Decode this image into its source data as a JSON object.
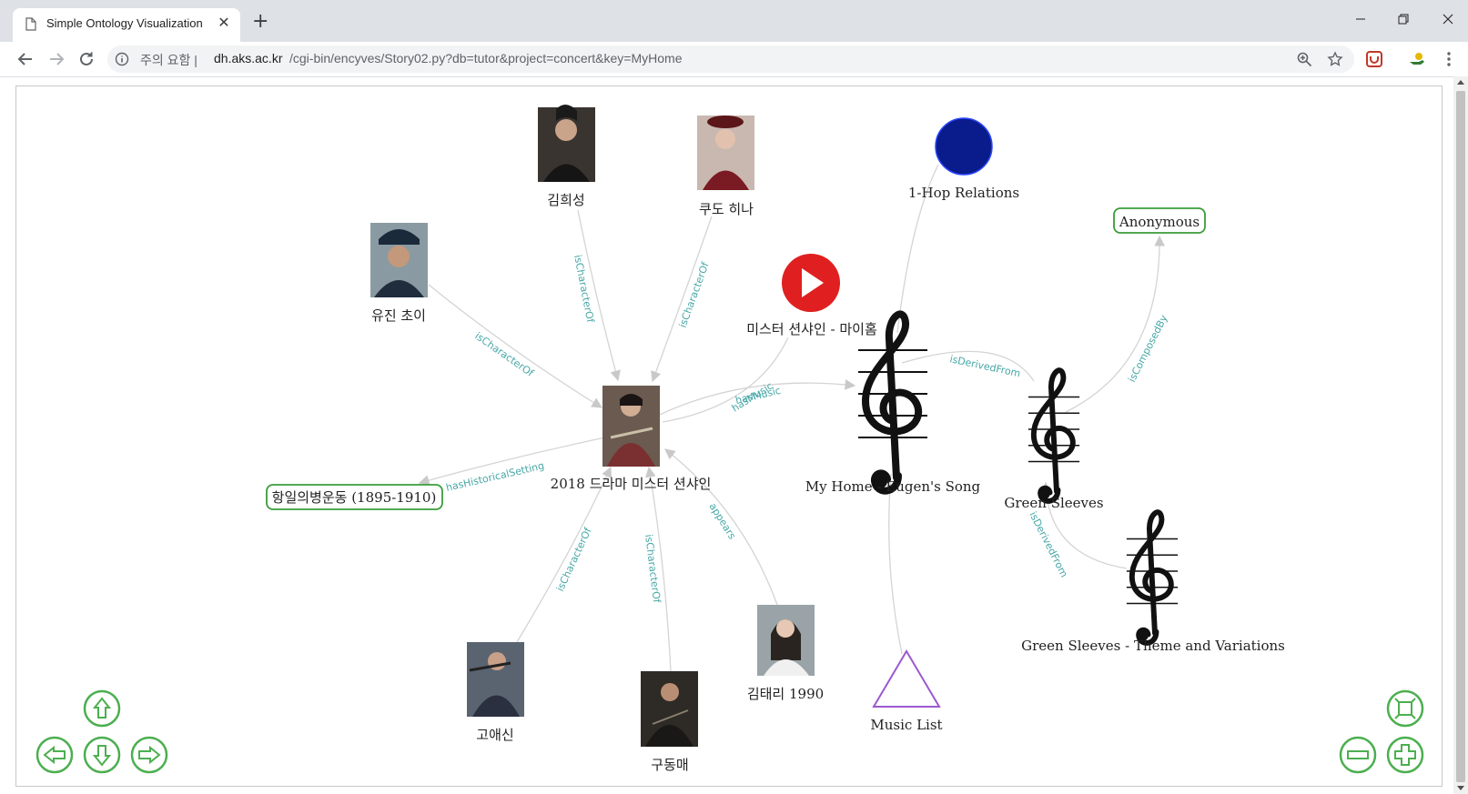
{
  "browser": {
    "tab_title": "Simple Ontology Visualization",
    "tab_close": "✕",
    "new_tab": "+",
    "url_prefix": "주의 요함 |",
    "url_domain": "dh.aks.ac.kr",
    "url_path": "/cgi-bin/encyves/Story02.py?db=tutor&project=concert&key=MyHome",
    "icons": [
      "back-icon",
      "forward-icon",
      "reload-icon",
      "info-icon",
      "zoom-icon",
      "star-icon",
      "extension-icon",
      "profile-icon",
      "menu-icon"
    ]
  },
  "graph": {
    "nodes": {
      "kim_hui_seong": "김희성",
      "kudo_hina": "쿠도 히나",
      "one_hop": "1-Hop Relations",
      "anonymous": "Anonymous",
      "eugene_choi": "유진 초이",
      "video": "미스터 션샤인 - 마이홈",
      "drama": "2018 드라마 미스터 션샤인",
      "my_home": "My Home - Eugen's Song",
      "green_sleeves": "Green Sleeves",
      "righteous_army": "항일의병운동 (1895-1910)",
      "gs_theme": "Green Sleeves - Theme and Variations",
      "go_ae_shin": "고애신",
      "gu_dong_mae": "구동매",
      "kim_tae_ri": "김태리 1990",
      "music_list": "Music List"
    },
    "edges": {
      "ischaracterof": "isCharacterOf",
      "hasmusic": "hasMusic",
      "hasmusic_overlap": "hasMusic",
      "isderivedfrom": "isDerivedFrom",
      "iscomposedby": "isComposedBy",
      "hashistoricalsetting": "hasHistoricalSetting",
      "appears": "appears"
    },
    "colors": {
      "edge_label": "#49a7a7",
      "box_border": "#3a9d3a",
      "control_green": "#4caf50",
      "one_hop_circle": "#0a1b8c",
      "youtube_red": "#e02020",
      "triangle": "#9b59d0"
    }
  }
}
